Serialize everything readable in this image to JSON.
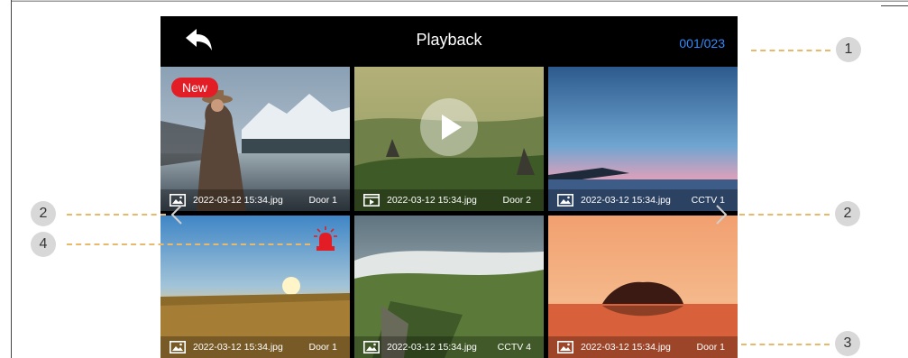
{
  "header": {
    "title": "Playback",
    "counter": "001/023"
  },
  "tiles": [
    {
      "badge": "New",
      "filename": "2022-03-12 15:34.jpg",
      "source": "Door 1",
      "icon": "photo-icon"
    },
    {
      "filename": "2022-03-12 15:34.jpg",
      "source": "Door 2",
      "icon": "video-icon"
    },
    {
      "filename": "2022-03-12 15:34.jpg",
      "source": "CCTV 1",
      "icon": "photo-icon"
    },
    {
      "filename": "2022-03-12 15:34.jpg",
      "source": "Door 1",
      "icon": "photo-icon",
      "alert": "alarm-icon"
    },
    {
      "filename": "2022-03-12 15:34.jpg",
      "source": "CCTV 4",
      "icon": "photo-icon"
    },
    {
      "filename": "2022-03-12 15:34.jpg",
      "source": "Door 1",
      "icon": "photo-icon"
    }
  ],
  "callouts": {
    "c1": "1",
    "c2_left": "2",
    "c2_right": "2",
    "c3": "3",
    "c4": "4"
  },
  "colors": {
    "accent": "#2f8bff",
    "badge": "#e21d25",
    "alarm": "#e21d25",
    "callout_line": "#e8b96a",
    "callout_circle": "#d8d8d8"
  }
}
